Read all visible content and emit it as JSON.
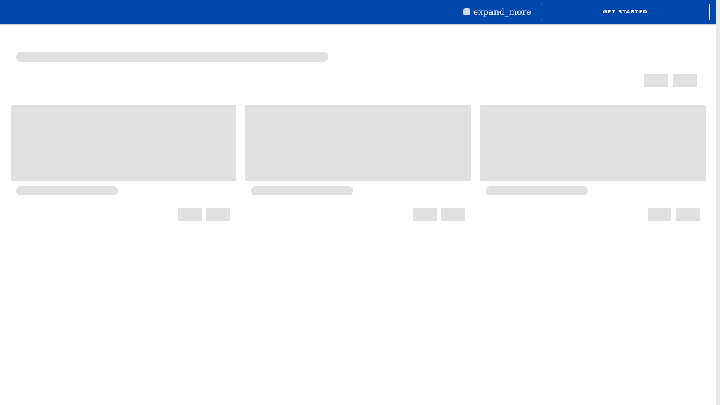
{
  "header": {
    "menu_label": "expand_more",
    "cta_label": "GET STARTED",
    "background_color": "#0047ab"
  },
  "skeleton": {
    "placeholder_color": "#e0e0e0",
    "cards": [
      {},
      {},
      {}
    ]
  }
}
